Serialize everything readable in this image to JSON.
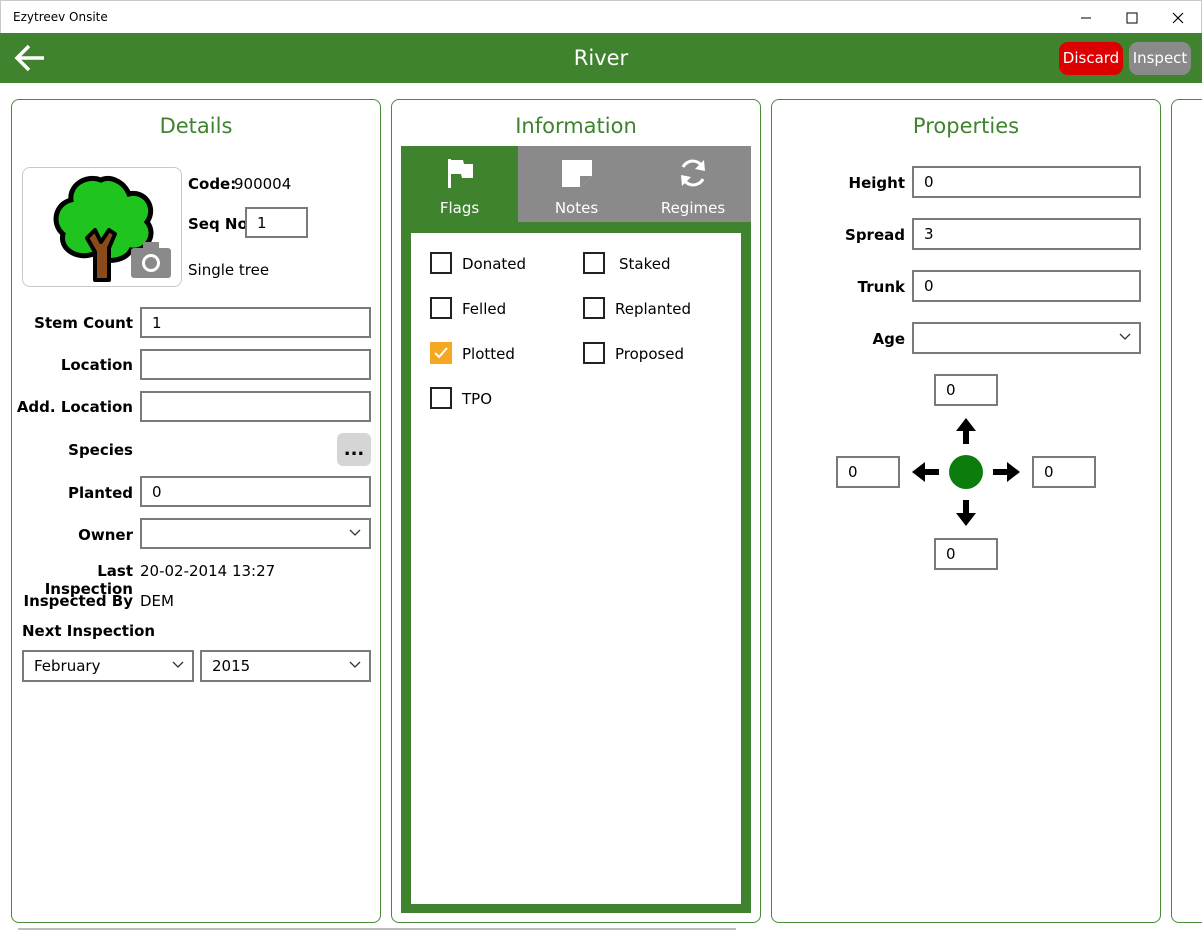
{
  "window": {
    "title": "Ezytreev Onsite"
  },
  "header": {
    "title": "River",
    "discard_label": "Discard",
    "inspect_label": "Inspect"
  },
  "details": {
    "title": "Details",
    "code_label": "Code:",
    "code_value": "900004",
    "seq_label": "Seq No",
    "seq_value": "1",
    "tree_type": "Single tree",
    "stem_count_label": "Stem Count",
    "stem_count_value": "1",
    "location_label": "Location",
    "location_value": "",
    "add_location_label": "Add. Location",
    "add_location_value": "",
    "species_label": "Species",
    "species_button": "...",
    "planted_label": "Planted",
    "planted_value": "0",
    "owner_label": "Owner",
    "owner_value": "",
    "last_inspection_label": "Last Inspection",
    "last_inspection_value": "20-02-2014 13:27",
    "inspected_by_label": "Inspected By",
    "inspected_by_value": "DEM",
    "next_inspection_label": "Next Inspection",
    "next_month": "February",
    "next_year": "2015"
  },
  "information": {
    "title": "Information",
    "tabs": [
      {
        "label": "Flags",
        "icon": "flag-icon",
        "active": true
      },
      {
        "label": "Notes",
        "icon": "note-icon",
        "active": false
      },
      {
        "label": "Regimes",
        "icon": "refresh-icon",
        "active": false
      }
    ],
    "flags": [
      {
        "label": "Donated",
        "checked": false
      },
      {
        "label": "Staked",
        "checked": false
      },
      {
        "label": "Felled",
        "checked": false
      },
      {
        "label": "Replanted",
        "checked": false
      },
      {
        "label": "Plotted",
        "checked": true
      },
      {
        "label": "Proposed",
        "checked": false
      },
      {
        "label": "TPO",
        "checked": false
      }
    ]
  },
  "properties": {
    "title": "Properties",
    "height_label": "Height",
    "height_value": "0",
    "spread_label": "Spread",
    "spread_value": "3",
    "trunk_label": "Trunk",
    "trunk_value": "0",
    "age_label": "Age",
    "age_value": "",
    "compass": {
      "north": "0",
      "west": "0",
      "east": "0",
      "south": "0"
    }
  },
  "colors": {
    "brand_green": "#3f832f",
    "discard_red": "#dd0000",
    "inspect_gray": "#8a8a8a",
    "check_orange": "#f5a623"
  }
}
